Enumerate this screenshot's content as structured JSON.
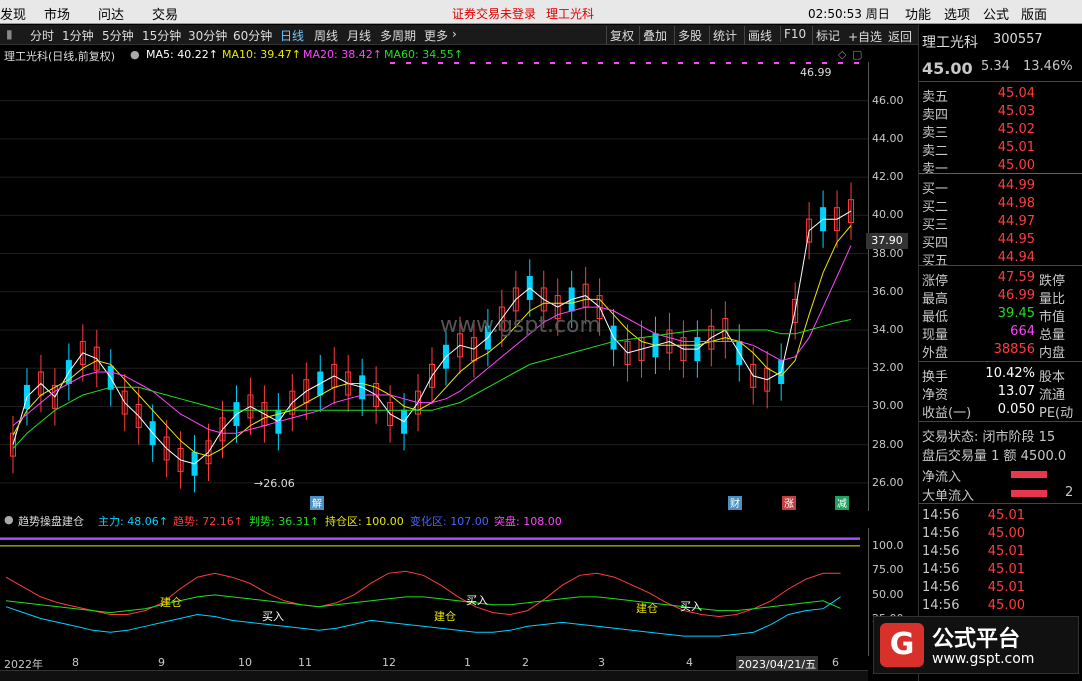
{
  "menubar": {
    "items": [
      "发现",
      "市场",
      "问达",
      "交易"
    ],
    "status_login": "证券交易未登录",
    "stock_name": "理工光科",
    "clock": "02:50:53 周日",
    "right_items": [
      "功能",
      "选项",
      "公式",
      "版面"
    ]
  },
  "periods": [
    "分时",
    "1分钟",
    "5分钟",
    "15分钟",
    "30分钟",
    "60分钟",
    "日线",
    "周线",
    "月线",
    "多周期",
    "更多"
  ],
  "active_period": "日线",
  "toolbar_right": [
    "复权",
    "叠加",
    "多股",
    "统计",
    "画线",
    "F10",
    "标记",
    "+自选",
    "返回"
  ],
  "ma_legend": {
    "title": "理工光科(日线,前复权)",
    "ma5": "MA5: 40.22↑",
    "ma10": "MA10: 39.47↑",
    "ma20": "MA20: 38.42↑",
    "ma60": "MA60: 34.55↑"
  },
  "y_ticks": [
    "46.00",
    "44.00",
    "42.00",
    "40.00",
    "38.00",
    "36.00",
    "34.00",
    "32.00",
    "30.00",
    "28.00",
    "26.00"
  ],
  "price_label": "37.90",
  "annotations": {
    "high": "46.99",
    "low": "26.06"
  },
  "event_markers": [
    "解",
    "财",
    "涨",
    "减"
  ],
  "indicator": {
    "title": "趋势操盘建仓",
    "zhuli": "主力: 48.06↑",
    "qushi": "趋势: 72.16↑",
    "panshi": "判势: 36.31↑",
    "chicang": "持仓区: 100.00",
    "bianshi": "变化区: 107.00",
    "tupan": "突盘: 108.00",
    "y_ticks": [
      "100.0",
      "75.00",
      "50.00",
      "25.00"
    ],
    "signals": [
      "建仓",
      "买入",
      "建仓",
      "买入",
      "建仓",
      "买入"
    ]
  },
  "date_axis": [
    "2022年",
    "8",
    "9",
    "10",
    "11",
    "12",
    "1",
    "2",
    "3",
    "4",
    "2023/04/21/五",
    "6"
  ],
  "quote": {
    "name": "理工光科",
    "code": "300557",
    "price": "45.00",
    "change": "5.34",
    "pct": "13.46%",
    "sell": [
      {
        "k": "卖五",
        "v": "45.04"
      },
      {
        "k": "卖四",
        "v": "45.03"
      },
      {
        "k": "卖三",
        "v": "45.02"
      },
      {
        "k": "卖二",
        "v": "45.01"
      },
      {
        "k": "卖一",
        "v": "45.00"
      }
    ],
    "buy": [
      {
        "k": "买一",
        "v": "44.99"
      },
      {
        "k": "买二",
        "v": "44.98"
      },
      {
        "k": "买三",
        "v": "44.97"
      },
      {
        "k": "买四",
        "v": "44.95"
      },
      {
        "k": "买五",
        "v": "44.94"
      }
    ],
    "stats": [
      {
        "k": "涨停",
        "v": "47.59",
        "k2": "跌停"
      },
      {
        "k": "最高",
        "v": "46.99",
        "k2": "量比"
      },
      {
        "k": "最低",
        "v": "39.45",
        "k2": "市值"
      },
      {
        "k": "现量",
        "v": "664",
        "k2": "总量"
      },
      {
        "k": "外盘",
        "v": "38856",
        "k2": "内盘"
      }
    ],
    "stats2": [
      {
        "k": "换手",
        "v": "10.42%",
        "k2": "股本"
      },
      {
        "k": "净资",
        "v": "13.07",
        "k2": "流通"
      },
      {
        "k": "收益(一)",
        "v": "0.050",
        "k2": "PE(动"
      }
    ],
    "trade_status": "交易状态: 闭市阶段 15",
    "after_hours": "盘后交易量 1 额 4500.0",
    "net_inflow": "净流入",
    "big_inflow": "大单流入",
    "big_inflow_val": "2",
    "ticks": [
      {
        "t": "14:56",
        "p": "45.01"
      },
      {
        "t": "14:56",
        "p": "45.00"
      },
      {
        "t": "14:56",
        "p": "45.01"
      },
      {
        "t": "14:56",
        "p": "45.01"
      },
      {
        "t": "14:56",
        "p": "45.01"
      },
      {
        "t": "14:56",
        "p": "45.00"
      },
      {
        "t": "14:56",
        "p": "45.01"
      }
    ]
  },
  "logo": {
    "title": "公式平台",
    "url": "www.gspt.com"
  },
  "watermark": "www.gspt.com",
  "colors": {
    "up": "#ff3c3c",
    "down": "#00d2ff",
    "ma5": "#ffffff",
    "ma10": "#e8e800",
    "ma20": "#ff44ff",
    "ma60": "#22dd22"
  },
  "chart_data": {
    "type": "candlestick",
    "ylim": [
      25.0,
      47.5
    ],
    "series": [
      {
        "name": "MA5",
        "values": [
          28.0,
          30.5,
          31.2,
          30.5,
          31.8,
          32.8,
          32.5,
          31.5,
          30.2,
          29.5,
          28.6,
          27.8,
          27.2,
          27.0,
          27.6,
          28.8,
          29.6,
          30.0,
          29.6,
          29.2,
          30.2,
          30.8,
          31.2,
          31.6,
          31.2,
          31.0,
          30.6,
          29.6,
          29.2,
          30.2,
          31.6,
          32.6,
          33.2,
          33.0,
          33.6,
          34.6,
          35.6,
          36.2,
          35.6,
          35.2,
          35.6,
          35.8,
          35.2,
          33.6,
          32.8,
          33.0,
          33.2,
          33.4,
          33.0,
          33.0,
          33.6,
          34.0,
          32.8,
          31.6,
          31.4,
          31.8,
          35.0,
          39.2,
          39.8,
          39.8,
          40.22
        ]
      },
      {
        "name": "MA10",
        "values": [
          28.5,
          29.8,
          30.6,
          31.0,
          31.4,
          32.0,
          32.4,
          32.2,
          31.4,
          30.6,
          29.8,
          29.0,
          28.2,
          27.6,
          27.4,
          27.8,
          28.4,
          29.0,
          29.4,
          29.6,
          29.8,
          30.2,
          30.6,
          31.0,
          31.2,
          31.2,
          31.0,
          30.6,
          30.0,
          29.8,
          30.2,
          31.0,
          31.8,
          32.4,
          32.8,
          33.4,
          34.2,
          35.0,
          35.4,
          35.4,
          35.4,
          35.6,
          35.6,
          34.8,
          34.0,
          33.4,
          33.2,
          33.2,
          33.2,
          33.2,
          33.4,
          33.6,
          33.4,
          32.8,
          32.0,
          31.6,
          32.4,
          34.8,
          37.0,
          38.6,
          39.47
        ]
      },
      {
        "name": "MA20",
        "values": [
          29.0,
          29.6,
          30.2,
          30.8,
          31.2,
          31.6,
          31.8,
          31.8,
          31.6,
          31.2,
          30.8,
          30.2,
          29.6,
          29.2,
          28.8,
          28.6,
          28.6,
          28.8,
          29.0,
          29.2,
          29.4,
          29.6,
          29.8,
          30.2,
          30.4,
          30.6,
          30.6,
          30.6,
          30.4,
          30.2,
          30.2,
          30.4,
          30.8,
          31.4,
          32.0,
          32.6,
          33.2,
          33.8,
          34.4,
          34.8,
          35.0,
          35.2,
          35.2,
          35.0,
          34.6,
          34.2,
          33.8,
          33.6,
          33.4,
          33.4,
          33.4,
          33.4,
          33.4,
          33.2,
          32.8,
          32.4,
          32.6,
          33.6,
          35.2,
          36.8,
          38.42
        ]
      },
      {
        "name": "MA60",
        "values": [
          27.8,
          28.6,
          29.2,
          29.8,
          30.2,
          30.6,
          30.8,
          31.0,
          31.0,
          31.0,
          30.8,
          30.6,
          30.4,
          30.2,
          30.0,
          29.8,
          29.8,
          29.8,
          29.8,
          29.8,
          29.8,
          29.8,
          29.8,
          29.8,
          29.8,
          29.8,
          29.8,
          29.8,
          29.8,
          29.8,
          29.8,
          30.0,
          30.2,
          30.6,
          31.0,
          31.4,
          31.8,
          32.2,
          32.4,
          32.6,
          32.8,
          33.0,
          33.2,
          33.4,
          33.5,
          33.6,
          33.7,
          33.8,
          33.9,
          34.0,
          34.0,
          34.0,
          34.0,
          34.0,
          34.0,
          33.8,
          33.8,
          34.0,
          34.2,
          34.4,
          34.55
        ]
      }
    ],
    "indicator_series": [
      {
        "name": "趋势",
        "values": [
          68,
          58,
          48,
          42,
          38,
          34,
          30,
          30,
          34,
          42,
          56,
          68,
          72,
          68,
          62,
          52,
          44,
          40,
          38,
          42,
          50,
          62,
          72,
          74,
          70,
          60,
          48,
          38,
          32,
          30,
          34,
          46,
          60,
          70,
          72,
          68,
          60,
          52,
          42,
          34,
          30,
          28,
          30,
          36,
          44,
          56,
          66,
          72,
          72.16
        ]
      },
      {
        "name": "判势",
        "values": [
          44,
          42,
          40,
          38,
          36,
          34,
          32,
          34,
          36,
          40,
          44,
          48,
          50,
          48,
          46,
          44,
          42,
          40,
          38,
          40,
          42,
          44,
          46,
          48,
          48,
          46,
          44,
          42,
          40,
          40,
          42,
          44,
          46,
          48,
          48,
          46,
          44,
          42,
          40,
          38,
          36,
          34,
          34,
          36,
          38,
          40,
          42,
          44,
          36.31
        ]
      },
      {
        "name": "主力",
        "values": [
          38,
          32,
          26,
          22,
          18,
          14,
          12,
          14,
          18,
          22,
          26,
          30,
          28,
          24,
          22,
          20,
          18,
          16,
          14,
          16,
          20,
          24,
          22,
          20,
          18,
          16,
          14,
          12,
          12,
          14,
          18,
          20,
          22,
          20,
          18,
          16,
          14,
          12,
          10,
          8,
          8,
          8,
          10,
          12,
          20,
          30,
          34,
          36,
          48.06
        ]
      }
    ]
  }
}
